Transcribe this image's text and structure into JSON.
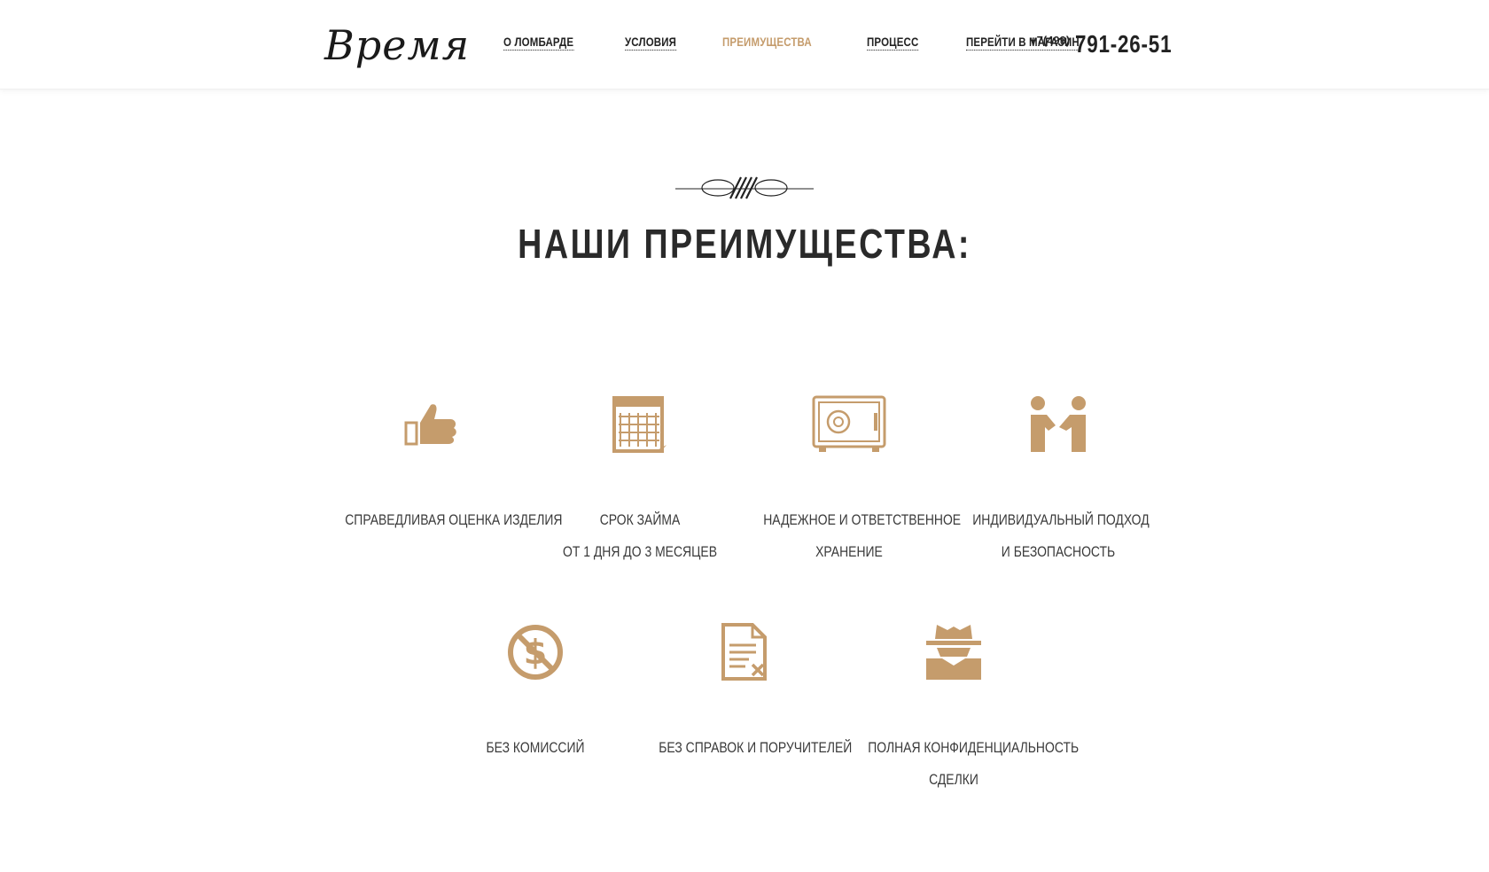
{
  "header": {
    "logo_text": "Время",
    "nav": [
      {
        "label": "О ЛОМБАРДЕ",
        "active": false
      },
      {
        "label": "УСЛОВИЯ",
        "active": false
      },
      {
        "label": "ПРЕИМУЩЕСТВА",
        "active": true
      },
      {
        "label": "ПРОЦЕСС",
        "active": false
      },
      {
        "label": "ПЕРЕЙТИ В МАГАЗИН",
        "active": false
      }
    ],
    "phone_code": "+7(499)",
    "phone_number": "791-26-51"
  },
  "section": {
    "ornament_icon": "flourish-divider-icon",
    "title": "НАШИ ПРЕИМУЩЕСТВА:"
  },
  "features": [
    {
      "icon": "thumbs-up-icon",
      "lines": [
        "СПРАВЕДЛИВАЯ ОЦЕНКА ИЗДЕЛИЯ"
      ]
    },
    {
      "icon": "calendar-icon",
      "lines": [
        "СРОК ЗАЙМА",
        "ОТ 1 ДНЯ ДО 3 МЕСЯЦЕВ"
      ]
    },
    {
      "icon": "safe-icon",
      "lines": [
        "НАДЕЖНОЕ И ОТВЕТСТВЕННОЕ",
        "ХРАНЕНИЕ"
      ]
    },
    {
      "icon": "handshake-icon",
      "lines": [
        "ИНДИВИДУАЛЬНЫЙ ПОДХОД",
        "И БЕЗОПАСНОСТЬ"
      ]
    },
    {
      "icon": "no-dollar-icon",
      "lines": [
        "БЕЗ КОМИССИЙ"
      ]
    },
    {
      "icon": "document-cancel-icon",
      "lines": [
        "БЕЗ СПРАВОК И ПОРУЧИТЕЛЕЙ"
      ]
    },
    {
      "icon": "incognito-icon",
      "lines": [
        "ПОЛНАЯ КОНФИДЕНЦИАЛЬНОСТЬ",
        "СДЕЛКИ"
      ]
    }
  ],
  "colors": {
    "accent": "#c59c6c",
    "text": "#2a2a2a"
  }
}
